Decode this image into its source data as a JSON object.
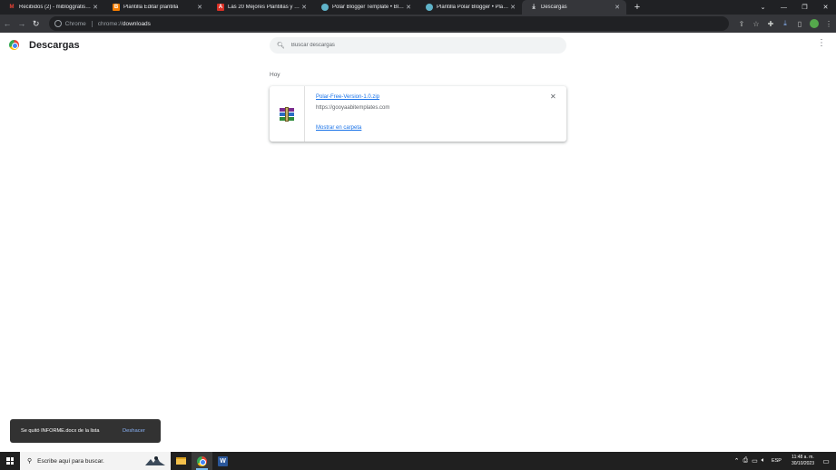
{
  "tabs": [
    {
      "title": "Recibidos (2) - mibloggratisperi",
      "favicon": "gmail-icon",
      "color": "#ea4335",
      "glyph": "M"
    },
    {
      "title": "Plantilla Editar plantilla",
      "favicon": "blogger-icon",
      "color": "#f57d00",
      "glyph": "B"
    },
    {
      "title": "Las 20 Mejores Plantillas y Tem",
      "favicon": "site-icon",
      "color": "#d93025",
      "glyph": "A"
    },
    {
      "title": "Polar Blogger Template • Blogg",
      "favicon": "globe-icon",
      "color": "#5fb3c9",
      "glyph": ""
    },
    {
      "title": "Plantilla Polar Blogger • Plantill",
      "favicon": "globe-icon",
      "color": "#5fb3c9",
      "glyph": ""
    },
    {
      "title": "Descargas",
      "favicon": "download-icon",
      "color": "#35363a",
      "glyph": "⤓"
    }
  ],
  "address": {
    "chip": "Chrome",
    "scheme": "chrome://",
    "path": "downloads"
  },
  "page": {
    "title": "Descargas",
    "search_placeholder": "Buscar descargas"
  },
  "date_header": "Hoy",
  "download": {
    "filename": "Polar-Free-Version-1.0.zip",
    "source_url": "https://gooyaabitemplates.com",
    "show_in_folder": "Mostrar en carpeta"
  },
  "toast": {
    "message": "Se quitó INFORME.docx de la lista",
    "undo": "Deshacer"
  },
  "taskbar": {
    "search_placeholder": "Escribe aquí para buscar.",
    "language": "ESP",
    "time": "11:48 a. m.",
    "date": "30/10/2023"
  }
}
